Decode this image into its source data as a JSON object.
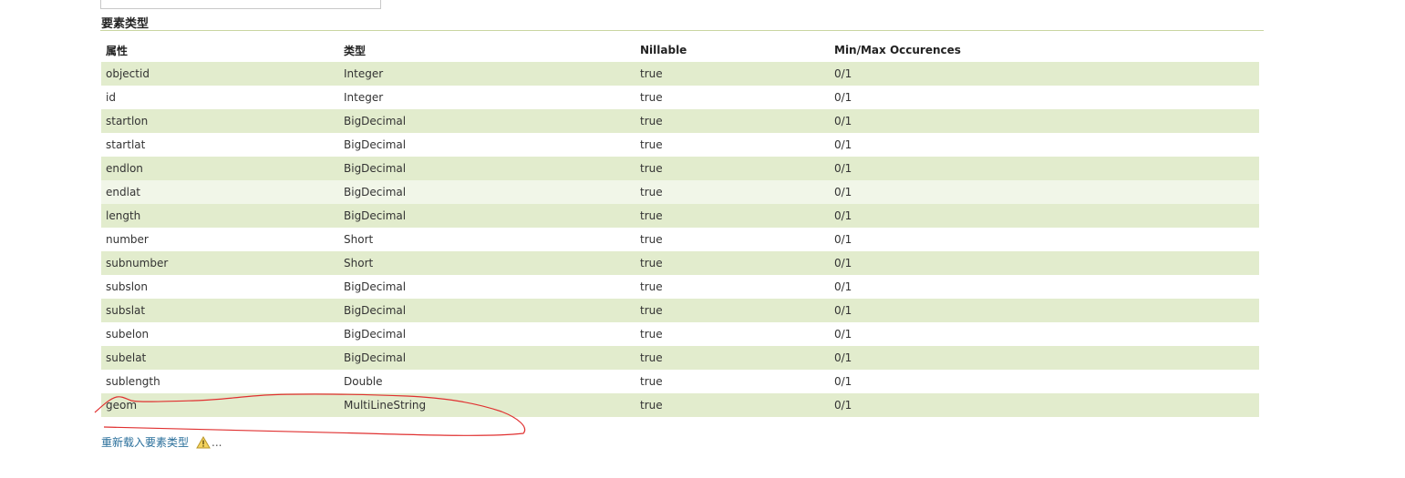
{
  "section": {
    "title": "要素类型"
  },
  "table": {
    "headers": [
      "属性",
      "类型",
      "Nillable",
      "Min/Max Occurences"
    ],
    "rows": [
      {
        "attribute": "objectid",
        "type": "Integer",
        "nillable": "true",
        "occurences": "0/1"
      },
      {
        "attribute": "id",
        "type": "Integer",
        "nillable": "true",
        "occurences": "0/1"
      },
      {
        "attribute": "startlon",
        "type": "BigDecimal",
        "nillable": "true",
        "occurences": "0/1"
      },
      {
        "attribute": "startlat",
        "type": "BigDecimal",
        "nillable": "true",
        "occurences": "0/1"
      },
      {
        "attribute": "endlon",
        "type": "BigDecimal",
        "nillable": "true",
        "occurences": "0/1"
      },
      {
        "attribute": "endlat",
        "type": "BigDecimal",
        "nillable": "true",
        "occurences": "0/1"
      },
      {
        "attribute": "length",
        "type": "BigDecimal",
        "nillable": "true",
        "occurences": "0/1"
      },
      {
        "attribute": "number",
        "type": "Short",
        "nillable": "true",
        "occurences": "0/1"
      },
      {
        "attribute": "subnumber",
        "type": "Short",
        "nillable": "true",
        "occurences": "0/1"
      },
      {
        "attribute": "subslon",
        "type": "BigDecimal",
        "nillable": "true",
        "occurences": "0/1"
      },
      {
        "attribute": "subslat",
        "type": "BigDecimal",
        "nillable": "true",
        "occurences": "0/1"
      },
      {
        "attribute": "subelon",
        "type": "BigDecimal",
        "nillable": "true",
        "occurences": "0/1"
      },
      {
        "attribute": "subelat",
        "type": "BigDecimal",
        "nillable": "true",
        "occurences": "0/1"
      },
      {
        "attribute": "sublength",
        "type": "Double",
        "nillable": "true",
        "occurences": "0/1"
      },
      {
        "attribute": "geom",
        "type": "MultiLineString",
        "nillable": "true",
        "occurences": "0/1"
      }
    ]
  },
  "reload": {
    "label": "重新载入要素类型",
    "icon": "warning-icon",
    "ellipsis": "..."
  },
  "annotation": {
    "color": "#e03030"
  },
  "colors": {
    "row_band": "#e2eccd",
    "link": "#2a6f9b",
    "rule": "#c9d6a1"
  }
}
